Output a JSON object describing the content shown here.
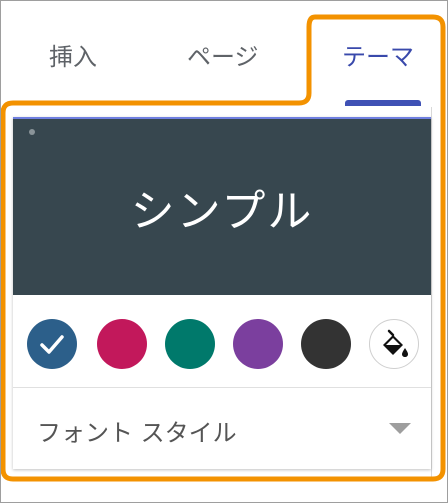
{
  "tabs": [
    {
      "label": "挿入"
    },
    {
      "label": "ページ"
    },
    {
      "label": "テーマ",
      "selected": true
    }
  ],
  "theme_preview": {
    "title": "シンプル",
    "background": "#37474f"
  },
  "color_swatches": [
    {
      "color": "#2c5f8a",
      "selected": true
    },
    {
      "color": "#c2185b",
      "selected": false
    },
    {
      "color": "#00796b",
      "selected": false
    },
    {
      "color": "#7b3f9e",
      "selected": false
    },
    {
      "color": "#333333",
      "selected": false
    }
  ],
  "custom_color": {
    "icon": "paint-bucket-icon"
  },
  "font_style": {
    "label": "フォント スタイル",
    "icon": "dropdown-arrow-icon"
  },
  "colors": {
    "accent": "#3f51b5",
    "highlight_outline": "#f39200"
  }
}
